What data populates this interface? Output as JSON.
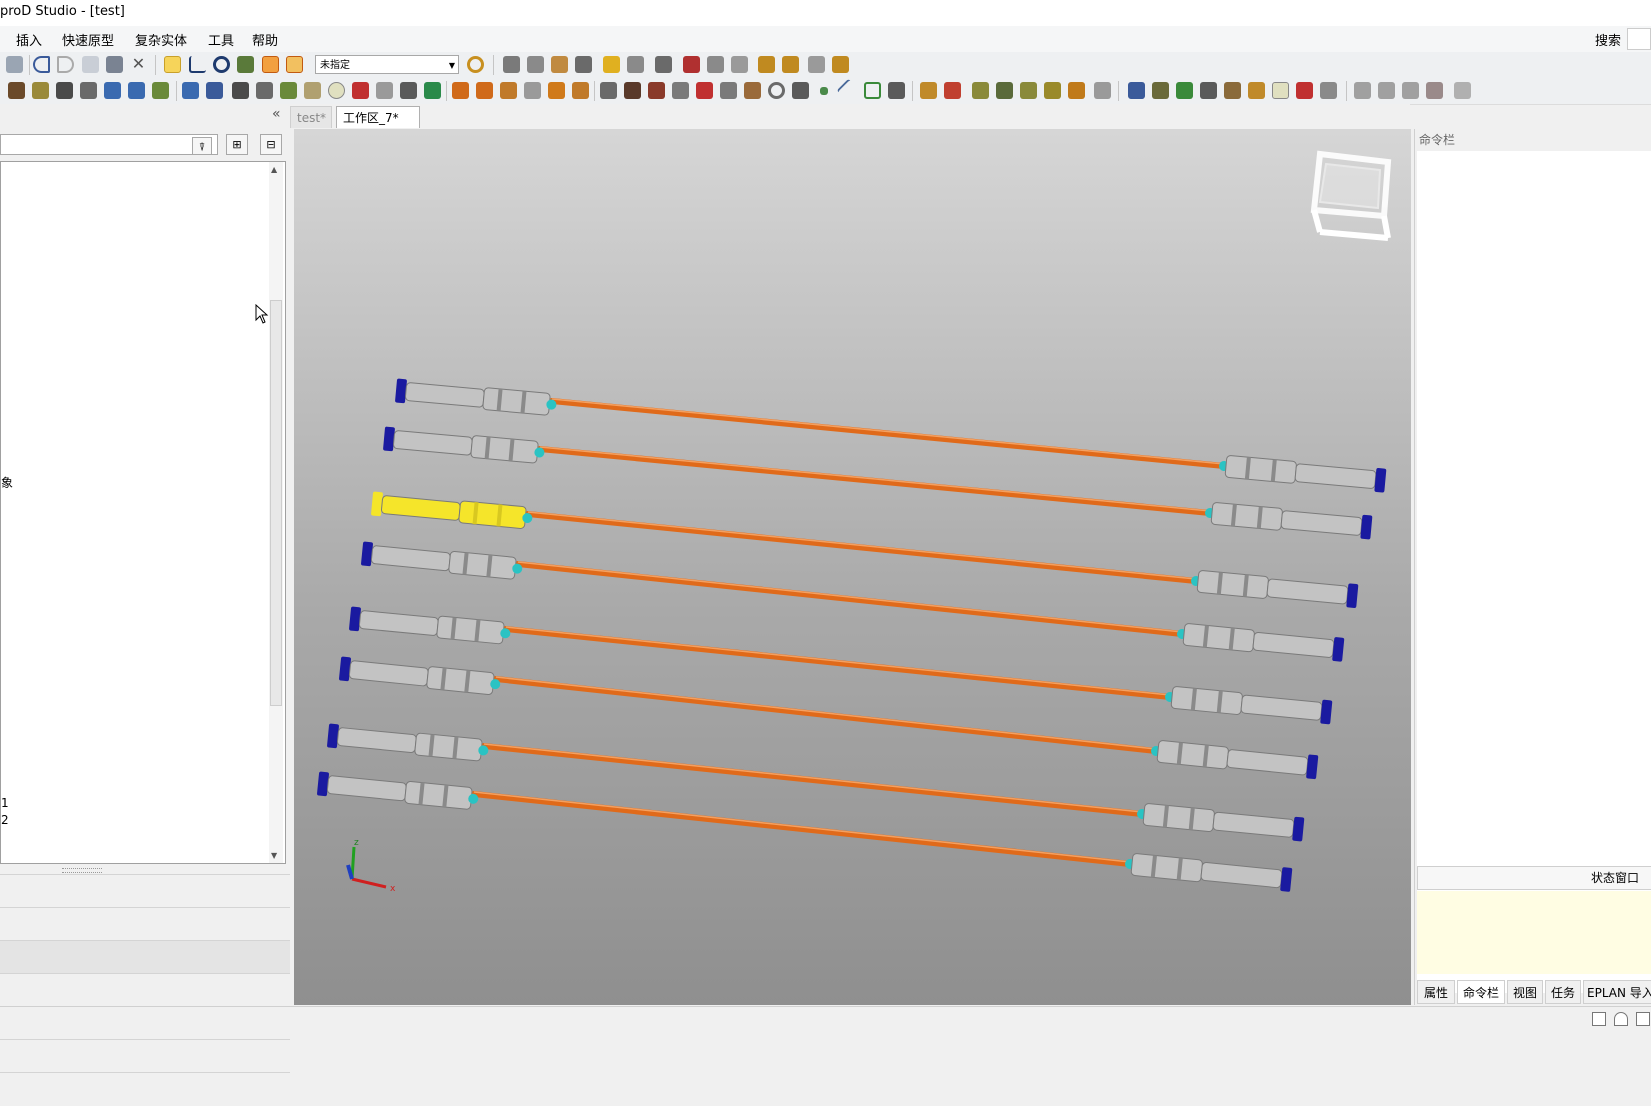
{
  "window": {
    "title": "proD Studio - [test]"
  },
  "menu": {
    "items": [
      "插入",
      "快速原型",
      "复杂实体",
      "工具",
      "帮助"
    ],
    "search_label": "搜索"
  },
  "toolbar": {
    "selection_combo_value": "未指定"
  },
  "left_panel": {
    "collapse_glyph": "«",
    "filter_placeholder": "",
    "tree_labels": [
      "象",
      "1",
      "2"
    ]
  },
  "tabs": {
    "doc": [
      "test*",
      "工作区_7*"
    ]
  },
  "viewport": {
    "axis_labels": {
      "x": "x",
      "z": "z"
    },
    "colors": {
      "tube": "#e06a1a",
      "connector_body": "#c3c3c3",
      "connector_end": "#1a1aa0",
      "highlight": "#f5e52a",
      "ring": "#2ac3c3"
    },
    "harness_count": 8,
    "highlighted_index": 2
  },
  "right_panel": {
    "command_bar_title": "命令栏",
    "status_window_title": "状态窗口",
    "bottom_tabs": [
      "属性",
      "命令栏",
      "视图",
      "任务",
      "EPLAN 导入"
    ]
  }
}
